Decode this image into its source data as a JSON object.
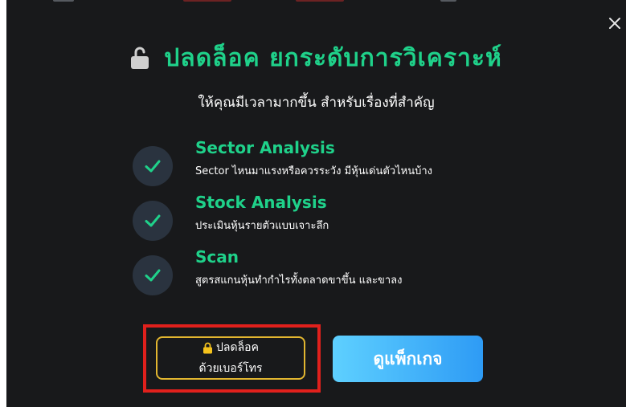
{
  "modal": {
    "title": "ปลดล็อค ยกระดับการวิเคราะห์",
    "subtitle": "ให้คุณมีเวลามากขึ้น สำหรับเรื่องที่สำคัญ",
    "close_label": "✕"
  },
  "features": [
    {
      "title": "Sector Analysis",
      "description": "Sector ไหนมาแรงหรือควรระวัง มีหุ้นเด่นตัวไหนบ้าง"
    },
    {
      "title": "Stock Analysis",
      "description": "ประเมินหุ้นรายตัวแบบเจาะลึก"
    },
    {
      "title": "Scan",
      "description": "สูตรสแกนหุ้นทำกำไรทั้งตลาดขาขึ้น และขาลง"
    }
  ],
  "buttons": {
    "unlock_line1": "ปลดล็อค",
    "unlock_line2": "ด้วยเบอร์โทร",
    "view_package": "ดูแพ็กเกจ"
  },
  "icons": {
    "title_icon": "unlock-icon",
    "unlock_button_icon": "lock-icon",
    "feature_icon": "check-icon",
    "close_icon": "close-icon"
  },
  "colors": {
    "modal_background": "#18191b",
    "accent_green": "#1fd18a",
    "check_circle": "#2a333f",
    "unlock_border": "#e2b630",
    "lock_yellow": "#f4c21c",
    "package_gradient_start": "#5ed0ff",
    "package_gradient_end": "#2e9bf5",
    "highlight_red": "#e0201c"
  }
}
